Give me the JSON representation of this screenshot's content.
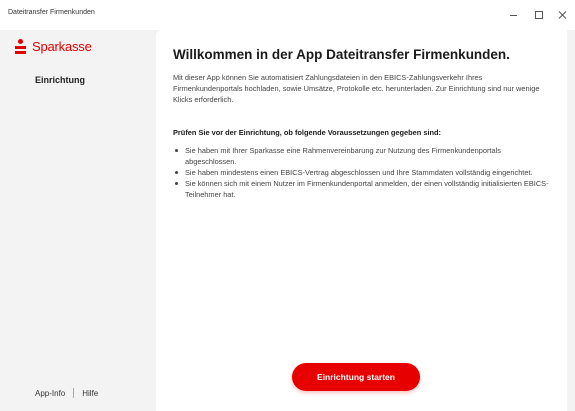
{
  "window": {
    "title": "Dateitransfer Firmenkunden",
    "controls": {
      "minimize_icon": "minimize-icon",
      "maximize_icon": "maximize-icon",
      "close_icon": "close-icon"
    }
  },
  "sidebar": {
    "brand": {
      "name": "Sparkasse",
      "logo_icon": "sparkasse-logo-icon",
      "color": "#e60000"
    },
    "items": [
      {
        "label": "Einrichtung",
        "active": true
      }
    ],
    "footer": {
      "app_info_label": "App-Info",
      "help_label": "Hilfe"
    }
  },
  "main": {
    "title": "Willkommen in der App Dateitransfer Firmenkunden.",
    "intro": "Mit dieser App können Sie automatisiert Zahlungsdateien in den EBICS-Zahlungsverkehr Ihres Firmenkundenportals hochladen, sowie Umsätze, Protokolle etc. herunterladen. Zur Einrichtung sind nur wenige Klicks erforderlich.",
    "prerequisites_heading": "Prüfen Sie vor der Einrichtung, ob folgende Voraussetzungen gegeben sind:",
    "prerequisites": [
      "Sie haben mit Ihrer Sparkasse eine Rahmenvereinbarung zur Nutzung des Firmenkundenportals abgeschlossen.",
      "Sie haben mindestens einen EBICS-Vertrag abgeschlossen und Ihre Stammdaten vollständig eingerichtet.",
      "Sie können sich mit einem Nutzer im Firmenkundenportal anmelden, der einen vollständig initialisierten EBICS-Teilnehmer hat."
    ],
    "start_button_label": "Einrichtung starten"
  },
  "colors": {
    "accent": "#e60000",
    "sidebar_background": "#f3f3f3",
    "content_background": "#ffffff"
  }
}
